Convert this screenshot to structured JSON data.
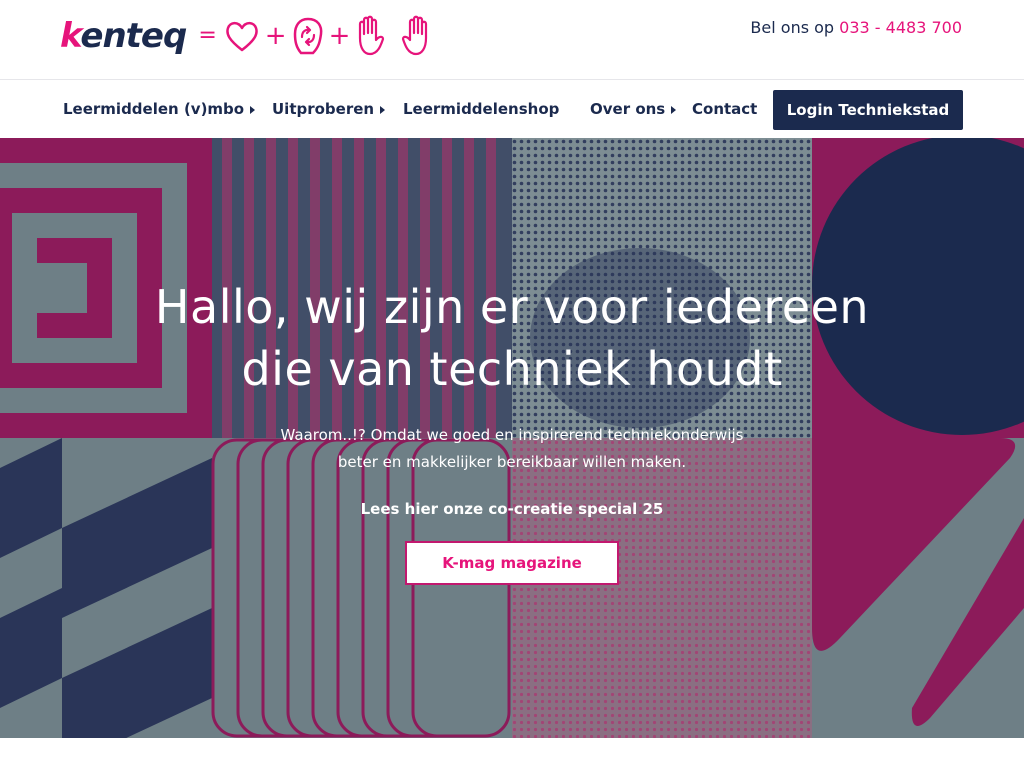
{
  "header": {
    "logo": {
      "text_k": "k",
      "text_rest": "enteq",
      "equals": "=",
      "plus": "+"
    },
    "phone_label": "Bel ons op",
    "phone_number": "033 - 4483 700"
  },
  "nav": {
    "items": [
      {
        "label": "Leermiddelen (v)mbo",
        "has_submenu": true
      },
      {
        "label": "Uitproberen",
        "has_submenu": true
      },
      {
        "label": "Leermiddelenshop",
        "has_submenu": false
      },
      {
        "label": "Over ons",
        "has_submenu": true
      },
      {
        "label": "Contact",
        "has_submenu": false
      }
    ],
    "login_label": "Login Techniekstad"
  },
  "hero": {
    "title_line1": "Hallo, wij zijn er voor iedereen",
    "title_line2": "die van techniek houdt",
    "sub_line1": "Waarom..!? Omdat we goed en inspirerend techniekonderwijs",
    "sub_line2": "beter en makkelijker bereikbaar willen maken.",
    "special_link": "Lees hier onze co-creatie special 25",
    "button_label": "K-mag magazine"
  },
  "colors": {
    "brand_magenta": "#e6147b",
    "navy": "#1b2a4e",
    "hero_magenta": "#8c1b5a",
    "hero_grey": "#6e7f86"
  }
}
